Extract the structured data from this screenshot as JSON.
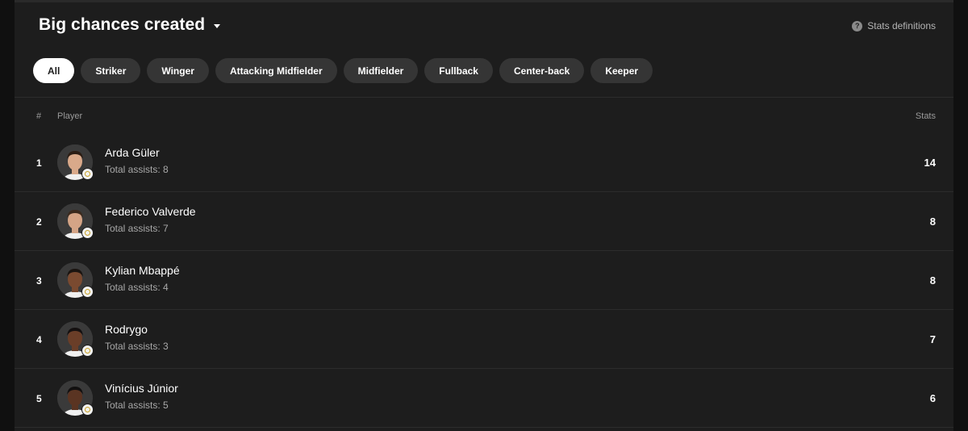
{
  "header": {
    "title": "Big chances created",
    "stats_definitions": "Stats definitions",
    "help_glyph": "?"
  },
  "filters": [
    {
      "label": "All",
      "active": true
    },
    {
      "label": "Striker",
      "active": false
    },
    {
      "label": "Winger",
      "active": false
    },
    {
      "label": "Attacking Midfielder",
      "active": false
    },
    {
      "label": "Midfielder",
      "active": false
    },
    {
      "label": "Fullback",
      "active": false
    },
    {
      "label": "Center-back",
      "active": false
    },
    {
      "label": "Keeper",
      "active": false
    }
  ],
  "table": {
    "col_rank": "#",
    "col_player": "Player",
    "col_stats": "Stats",
    "rows": [
      {
        "rank": "1",
        "name": "Arda Güler",
        "sub": "Total assists: 8",
        "stat": "14",
        "skin": "#d9a98a",
        "hair": "#2b1d14"
      },
      {
        "rank": "2",
        "name": "Federico Valverde",
        "sub": "Total assists: 7",
        "stat": "8",
        "skin": "#d4a486",
        "hair": "#3a2a1e"
      },
      {
        "rank": "3",
        "name": "Kylian Mbappé",
        "sub": "Total assists: 4",
        "stat": "8",
        "skin": "#7a4a30",
        "hair": "#1a1410"
      },
      {
        "rank": "4",
        "name": "Rodrygo",
        "sub": "Total assists: 3",
        "stat": "7",
        "skin": "#6a3e28",
        "hair": "#141010"
      },
      {
        "rank": "5",
        "name": "Vinícius Júnior",
        "sub": "Total assists: 5",
        "stat": "6",
        "skin": "#5a3422",
        "hair": "#121010"
      }
    ]
  },
  "colors": {
    "panel_bg": "#1d1d1d",
    "chip_bg": "#353535",
    "chip_active_bg": "#ffffff",
    "badge_accent": "#c9a227"
  }
}
